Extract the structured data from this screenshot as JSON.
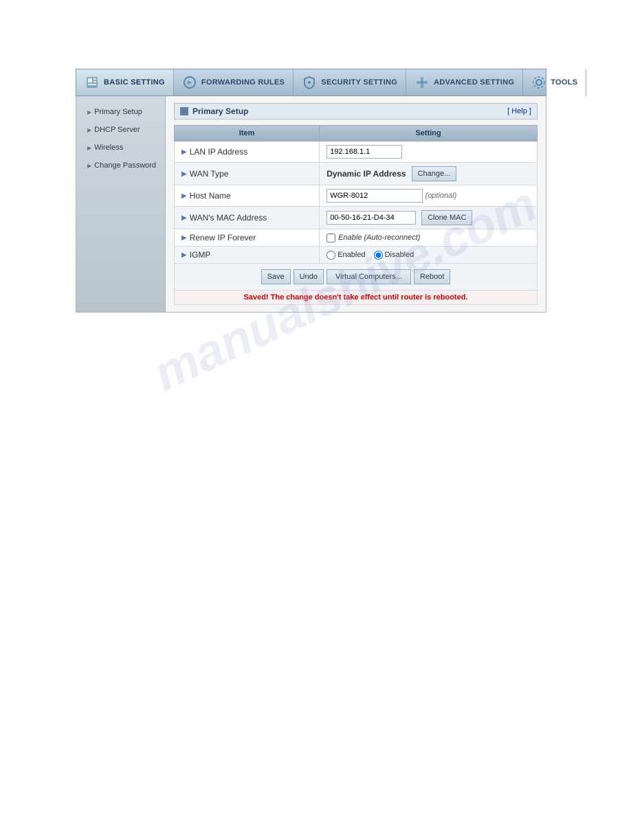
{
  "nav": {
    "items": [
      {
        "id": "basic-setting",
        "label": "BASIC SETTING",
        "icon": "🏠",
        "active": true
      },
      {
        "id": "forwarding-rules",
        "label": "FORWARDING RULES",
        "icon": "➡",
        "active": false
      },
      {
        "id": "security-setting",
        "label": "SECURITY SETTING",
        "icon": "🔒",
        "active": false
      },
      {
        "id": "advanced-setting",
        "label": "ADVANCED SETTING",
        "icon": "⚙",
        "active": false
      },
      {
        "id": "tools",
        "label": "TOOLS",
        "icon": "🔧",
        "active": false
      }
    ]
  },
  "sidebar": {
    "items": [
      {
        "id": "primary-setup",
        "label": "Primary Setup"
      },
      {
        "id": "dhcp-server",
        "label": "DHCP Server"
      },
      {
        "id": "wireless",
        "label": "Wireless"
      },
      {
        "id": "change-password",
        "label": "Change Password"
      }
    ]
  },
  "section": {
    "title": "Primary Setup",
    "help_label": "[ Help ]"
  },
  "table": {
    "headers": [
      "Item",
      "Setting"
    ],
    "rows": [
      {
        "id": "lan-ip",
        "label": "LAN IP Address",
        "value": "192.168.1.1",
        "type": "input"
      },
      {
        "id": "wan-type",
        "label": "WAN Type",
        "value": "Dynamic IP Address",
        "button": "Change...",
        "type": "wan"
      },
      {
        "id": "host-name",
        "label": "Host Name",
        "value": "WGR-8012",
        "optional": "(optional)",
        "type": "input-optional"
      },
      {
        "id": "wan-mac",
        "label": "WAN's MAC Address",
        "value": "00-50-16-21-D4-34",
        "button": "Clone MAC",
        "type": "input-button"
      },
      {
        "id": "renew-ip",
        "label": "Renew IP Forever",
        "checkbox_label": "Enable (Auto-reconnect)",
        "type": "checkbox"
      },
      {
        "id": "igmp",
        "label": "IGMP",
        "radio_options": [
          "Enabled",
          "Disabled"
        ],
        "radio_default": 1,
        "type": "radio"
      }
    ]
  },
  "actions": {
    "save": "Save",
    "undo": "Undo",
    "virtual_computers": "Virtual Computers...",
    "reboot": "Reboot"
  },
  "status_message": "Saved! The change doesn't take effect until router is rebooted.",
  "watermark": "manualshive.com"
}
